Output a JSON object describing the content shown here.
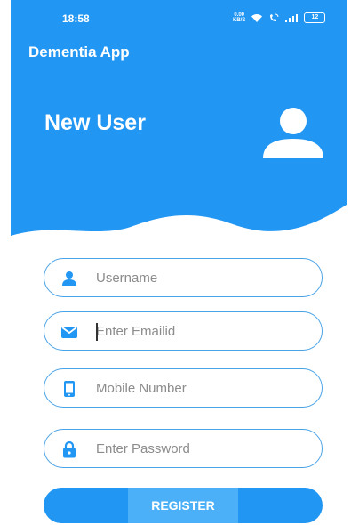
{
  "status_bar": {
    "time": "18:58",
    "net_speed_value": "0.00",
    "net_speed_unit": "KB/S",
    "battery": "12"
  },
  "app_bar": {
    "title": "Dementia App"
  },
  "header": {
    "title": "New User"
  },
  "form": {
    "username": {
      "placeholder": "Username",
      "value": ""
    },
    "email": {
      "placeholder": "Enter Emailid",
      "value": ""
    },
    "mobile": {
      "placeholder": "Mobile Number",
      "value": ""
    },
    "password": {
      "placeholder": "Enter Password",
      "value": ""
    }
  },
  "register_button": {
    "label": "REGISTER"
  },
  "icons": {
    "avatar": "person-icon",
    "username": "person-icon",
    "email": "mail-icon",
    "mobile": "phone-icon",
    "password": "lock-icon"
  },
  "colors": {
    "primary": "#2196f3",
    "field_border": "#4aa3e6",
    "register_highlight": "#4bb0f7"
  }
}
